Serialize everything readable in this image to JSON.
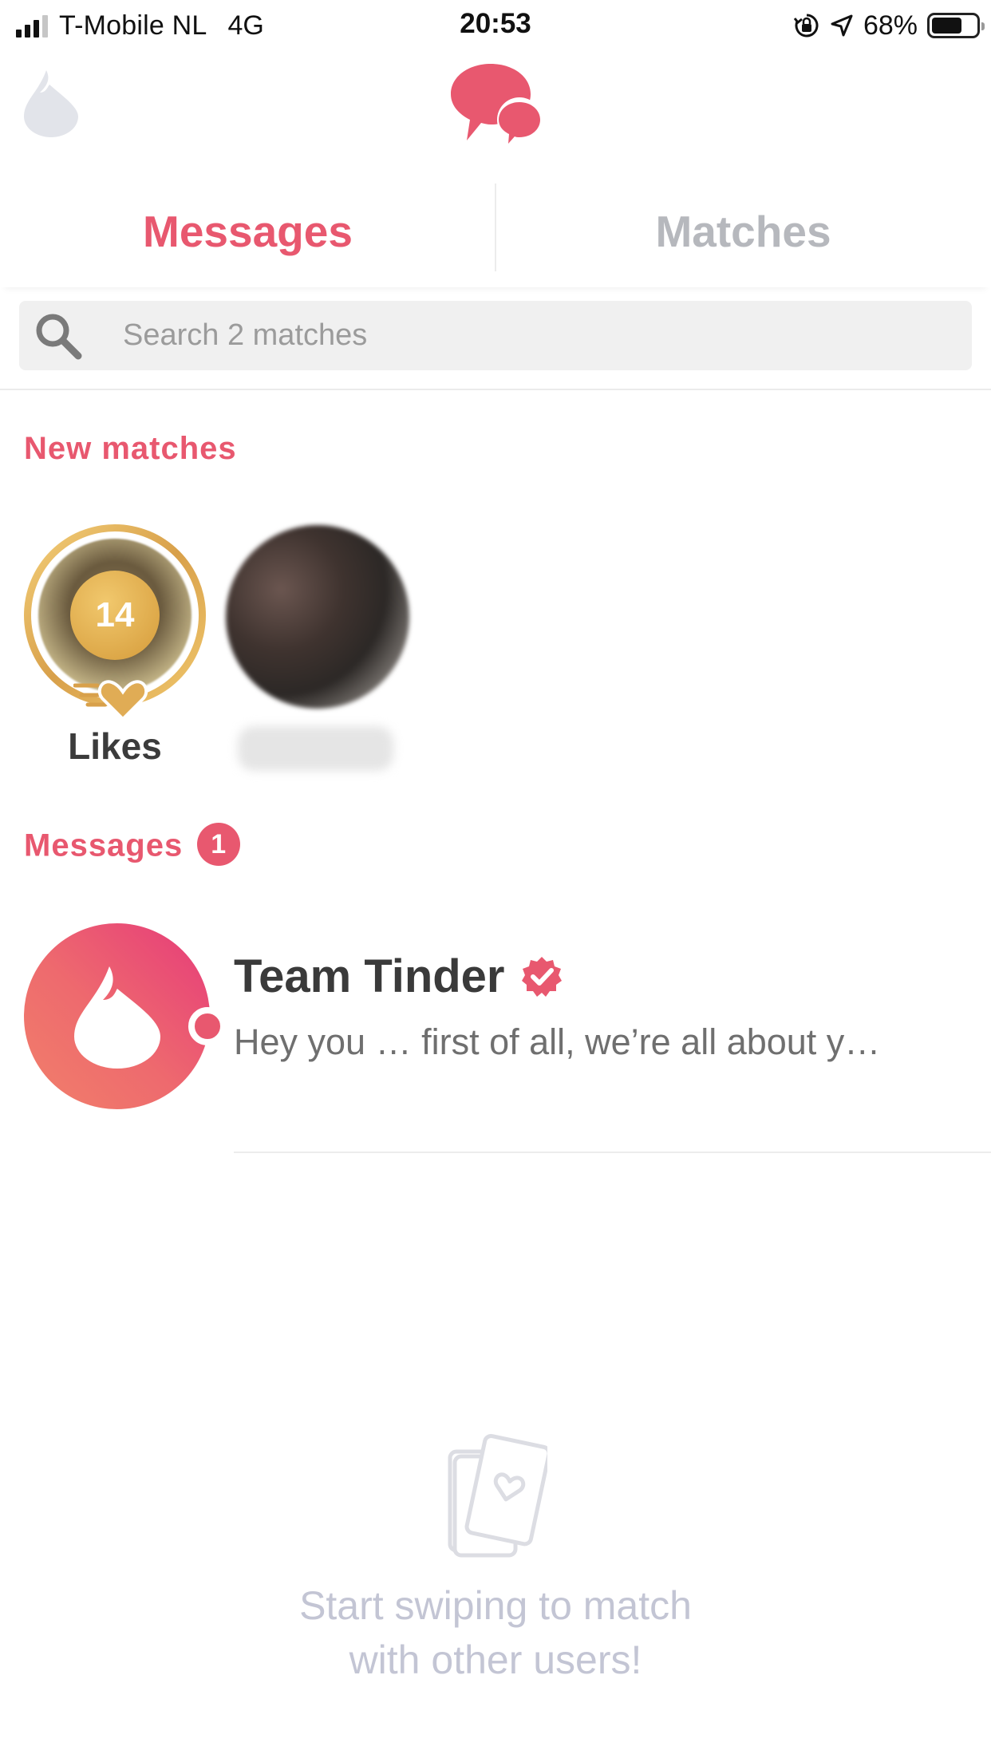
{
  "status_bar": {
    "carrier": "T-Mobile NL",
    "network": "4G",
    "time": "20:53",
    "battery_percent": "68%",
    "battery_level": 0.68,
    "icons": [
      "signal-icon",
      "rotation-lock-icon",
      "location-arrow-icon",
      "battery-icon"
    ]
  },
  "nav": {
    "left_icon": "flame-icon",
    "center_icon": "chat-bubbles-icon"
  },
  "tabs": [
    {
      "label": "Messages",
      "active": true
    },
    {
      "label": "Matches",
      "active": false
    }
  ],
  "search": {
    "placeholder": "Search 2 matches",
    "value": ""
  },
  "new_matches": {
    "title": "New matches",
    "likes": {
      "count": "14",
      "label": "Likes"
    }
  },
  "messages_section": {
    "title": "Messages",
    "badge": "1",
    "items": [
      {
        "name": "Team Tinder",
        "verified": true,
        "preview": "Hey you … first of all, we’re all about y…",
        "online": true
      }
    ]
  },
  "empty_state": {
    "line1": "Start swiping to match",
    "line2": "with other users!"
  },
  "colors": {
    "accent": "#e8586f",
    "inactive_tab": "#b6b8bd",
    "gold": "#d8a04a",
    "empty_text": "#c3c5d4"
  }
}
